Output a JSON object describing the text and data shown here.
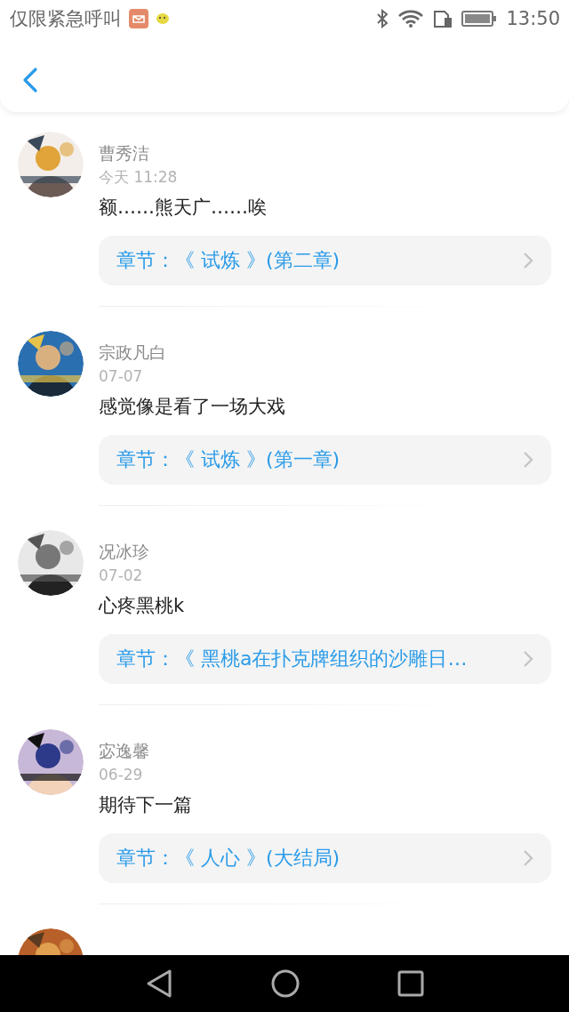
{
  "status_bar": {
    "carrier": "仅限紧急呼叫",
    "time": "13:50"
  },
  "comments": [
    {
      "user": "曹秀洁",
      "date": "今天 11:28",
      "text": "额……熊天广……唉",
      "chapter": "章节：《 试炼 》(第二章)",
      "avatar": {
        "kind": "picture"
      }
    },
    {
      "user": "宗政凡白",
      "date": "07-07",
      "text": "感觉像是看了一场大戏",
      "chapter": "章节：《 试炼 》(第一章)",
      "avatar": {
        "kind": "picture"
      }
    },
    {
      "user": "况冰珍",
      "date": "07-02",
      "text": "心疼黑桃k",
      "chapter": "章节：《 黑桃a在扑克牌组织的沙雕日…",
      "avatar": {
        "kind": "picture"
      }
    },
    {
      "user": "宓逸馨",
      "date": "06-29",
      "text": "期待下一篇",
      "chapter": "章节：《 人心 》(大结局)",
      "avatar": {
        "kind": "picture"
      }
    },
    {
      "avatar": {
        "kind": "picture"
      }
    }
  ]
}
